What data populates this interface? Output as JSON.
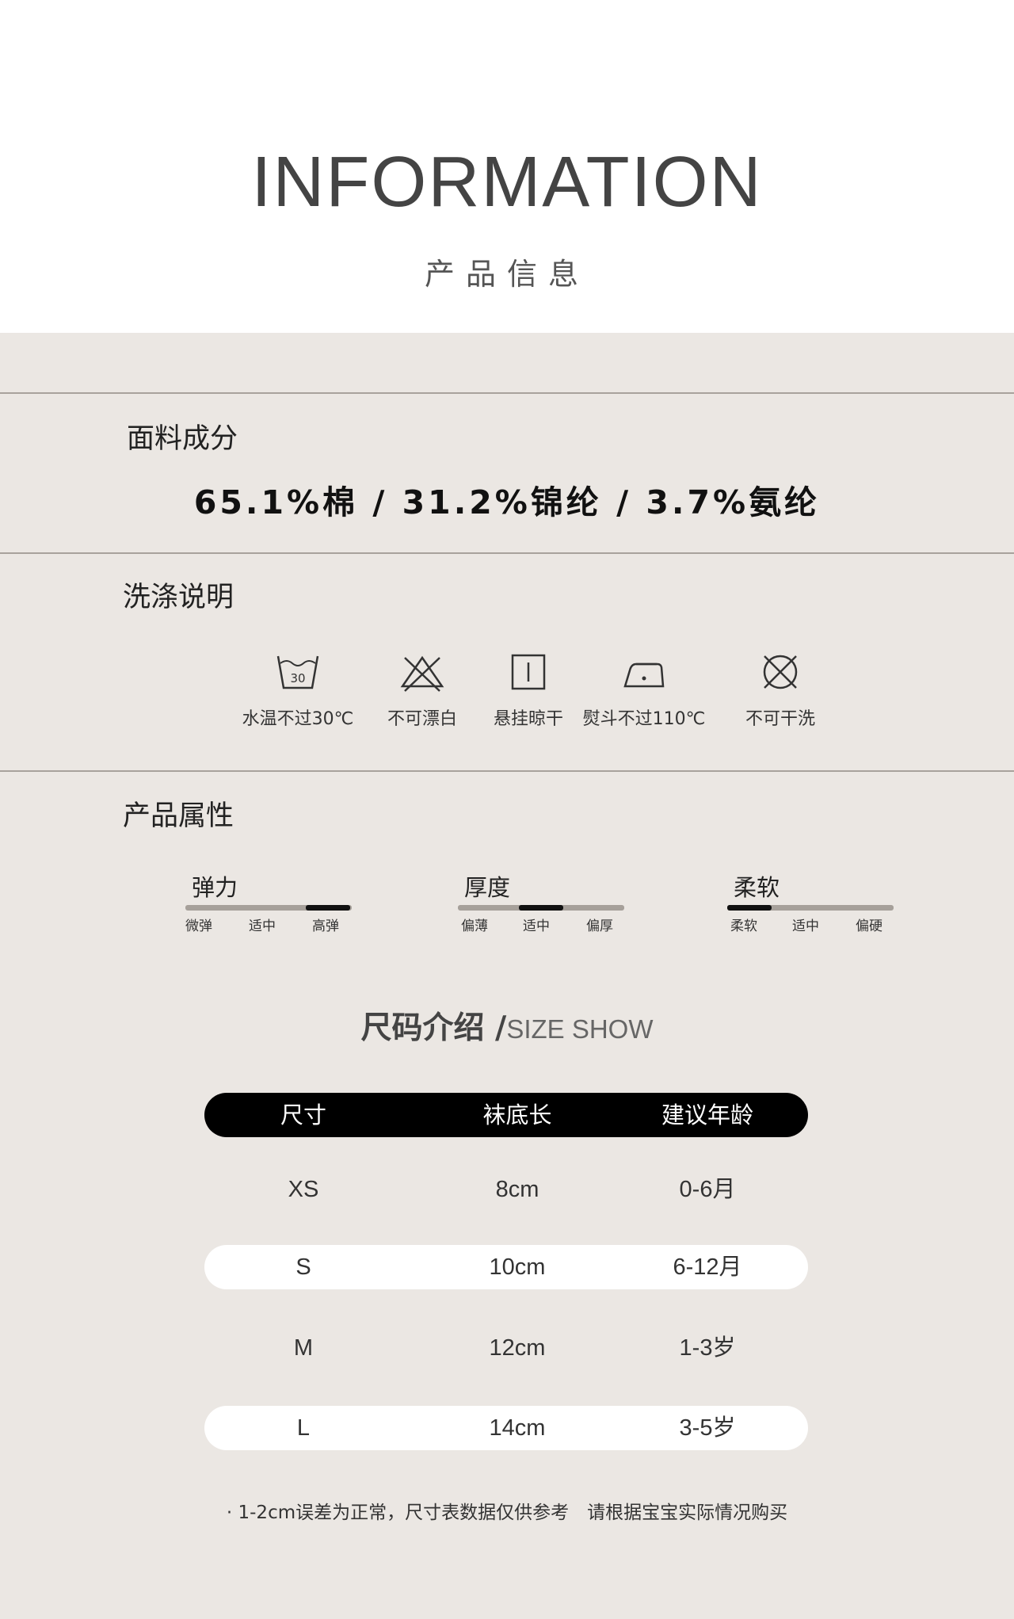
{
  "header": {
    "title": "INFORMATION",
    "subtitle": "产品信息"
  },
  "fabric": {
    "label": "面料成分",
    "composition": "65.1%棉 / 31.2%锦纶 / 3.7%氨纶"
  },
  "care": {
    "label": "洗涤说明",
    "items": [
      {
        "icon": "wash-30-icon",
        "icon_text": "30",
        "label": "水温不过30℃"
      },
      {
        "icon": "no-bleach-icon",
        "label": "不可漂白"
      },
      {
        "icon": "hang-dry-icon",
        "label": "悬挂晾干"
      },
      {
        "icon": "iron-icon",
        "label": "熨斗不过110℃"
      },
      {
        "icon": "no-dry-clean-icon",
        "label": "不可干洗"
      }
    ]
  },
  "attributes": {
    "label": "产品属性",
    "items": [
      {
        "name": "弹力",
        "levels": [
          "微弹",
          "适中",
          "高弹"
        ],
        "selected": 2
      },
      {
        "name": "厚度",
        "levels": [
          "偏薄",
          "适中",
          "偏厚"
        ],
        "selected": 1
      },
      {
        "name": "柔软",
        "levels": [
          "柔软",
          "适中",
          "偏硬"
        ],
        "selected": 0
      }
    ]
  },
  "size_chart": {
    "title_cn": "尺码介绍 /",
    "title_en": "SIZE SHOW",
    "headers": [
      "尺寸",
      "袜底长",
      "建议年龄"
    ],
    "rows": [
      [
        "XS",
        "8cm",
        "0-6月"
      ],
      [
        "S",
        "10cm",
        "6-12月"
      ],
      [
        "M",
        "12cm",
        "1-3岁"
      ],
      [
        "L",
        "14cm",
        "3-5岁"
      ]
    ],
    "note": "· 1-2cm误差为正常，尺寸表数据仅供参考　请根据宝宝实际情况购买"
  },
  "colors": {
    "panel_bg": "#ebe7e3",
    "title_text": "#444444",
    "bar_track": "#a6a09a",
    "bar_fill": "#111111",
    "table_header": "#000000",
    "row_stripe": "#ffffff"
  }
}
